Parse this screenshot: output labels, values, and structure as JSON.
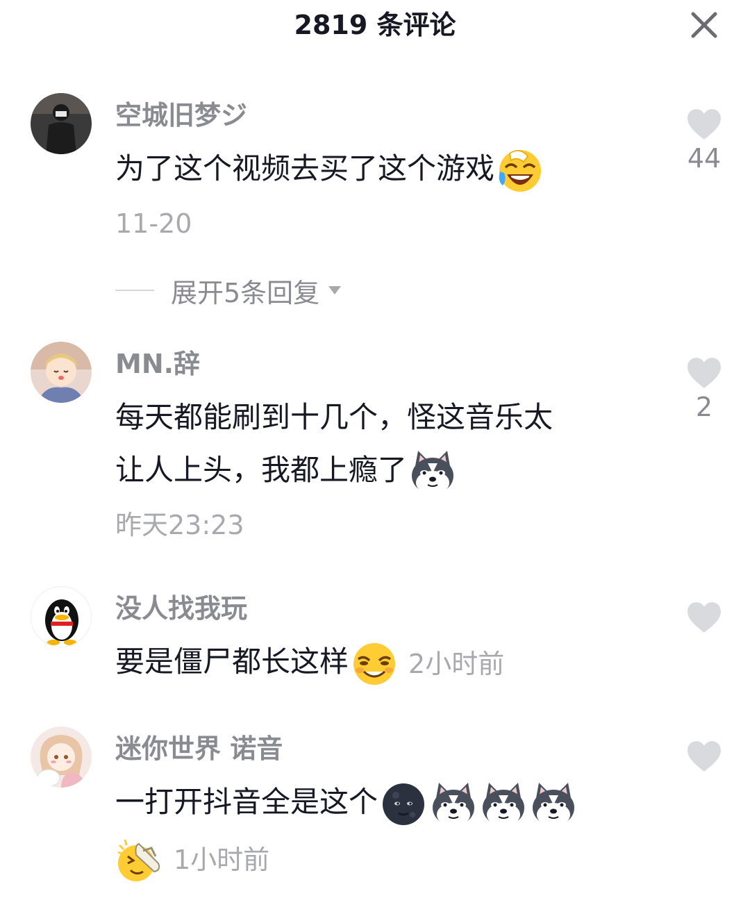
{
  "header": {
    "title": "2819 条评论"
  },
  "comments": [
    {
      "username": "空城旧梦ジ",
      "text": "为了这个视频去买了这个游戏",
      "emojis": [
        "crying-laughing-emoji"
      ],
      "time": "11-20",
      "likes": "44",
      "expand_label": "展开5条回复"
    },
    {
      "username": "MN.辞",
      "text_line1": "每天都能刷到十几个，怪这音乐太",
      "text_line2": "让人上头，我都上瘾了",
      "emojis": [
        "husky-dog-emoji"
      ],
      "time": "昨天23:23",
      "likes": "2"
    },
    {
      "username": "没人找我玩",
      "text": "要是僵尸都长这样",
      "emojis": [
        "smirking-emoji"
      ],
      "time": "2小时前"
    },
    {
      "username": "迷你世界 诺音",
      "text": "一打开抖音全是这个",
      "emojis": [
        "dark-moon-face-emoji",
        "husky-dog-emoji",
        "husky-dog-emoji",
        "husky-dog-emoji",
        "slipper-slap-emoji"
      ],
      "time": "1小时前"
    }
  ]
}
